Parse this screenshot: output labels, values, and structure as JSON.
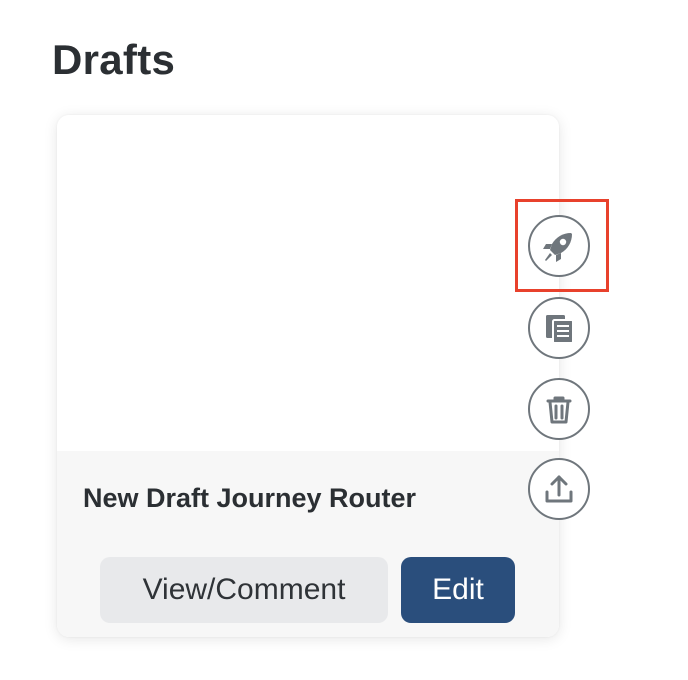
{
  "section": {
    "title": "Drafts"
  },
  "draft_card": {
    "name": "New Draft Journey Router",
    "view_comment_label": "View/Comment",
    "edit_label": "Edit",
    "edit_color": "#2a4e7c"
  },
  "actions": [
    {
      "icon": "rocket-icon",
      "action": "launch",
      "highlighted": true
    },
    {
      "icon": "copy-icon",
      "action": "duplicate"
    },
    {
      "icon": "trash-icon",
      "action": "delete"
    },
    {
      "icon": "upload-icon",
      "action": "export"
    }
  ],
  "highlight_color": "#e8412c"
}
